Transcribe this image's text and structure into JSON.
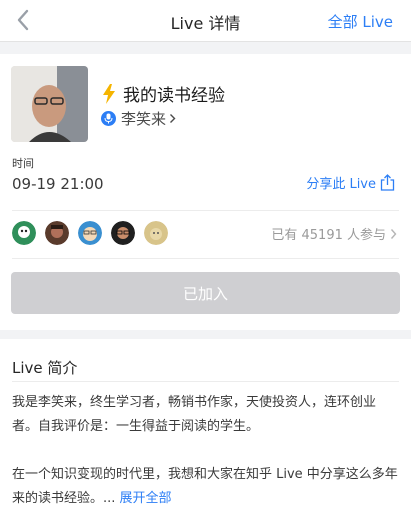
{
  "nav": {
    "title": "Live 详情",
    "right_label": "全部 Live"
  },
  "live": {
    "title": "我的读书经验",
    "speaker": "李笑来",
    "time_label": "时间",
    "time_value": "09-19 21:00",
    "share_label": "分享此 Live",
    "participants_text": "已有 45191 人参与",
    "joined_label": "已加入"
  },
  "intro": {
    "title": "Live 简介",
    "paragraph1": "我是李笑来，终生学习者，畅销书作家，天使投资人，连环创业者。自我评价是：一生得益于阅读的学生。",
    "paragraph2": "在一个知识变现的时代里，我想和大家在知乎 Live 中分享这么多年来的读书经验。... ",
    "expand_label": "展开全部"
  },
  "colors": {
    "accent": "#2c7ef5",
    "bolt": "#f5b400",
    "disabled_button": "#cfcfd2"
  }
}
